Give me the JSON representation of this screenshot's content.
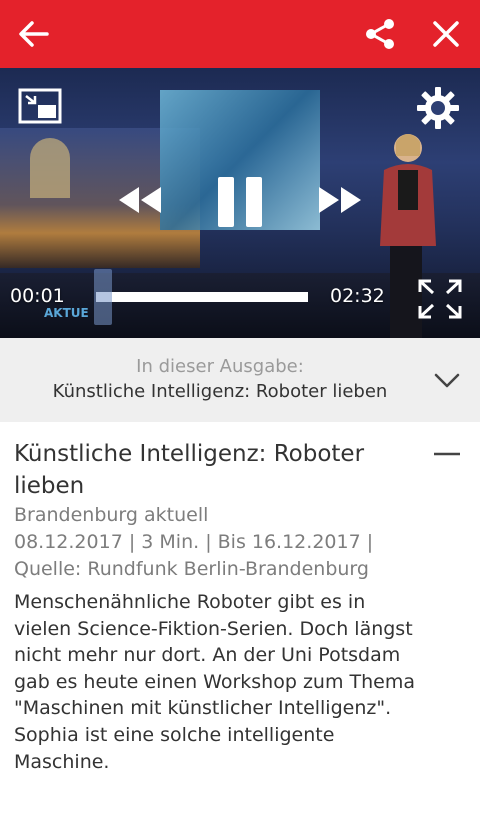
{
  "colors": {
    "brand_red": "#e4222b",
    "panel_grey": "#efefef"
  },
  "topbar": {
    "icons": {
      "back": "arrow-left-icon",
      "share": "share-icon",
      "close": "close-icon"
    }
  },
  "player": {
    "current_time": "00:01",
    "duration": "02:32",
    "progress_fraction": 0.007,
    "ticker": "AKTUE",
    "icons": {
      "pip": "picture-in-picture-icon",
      "settings": "gear-icon",
      "rewind": "rewind-icon",
      "pause": "pause-icon",
      "forward": "fast-forward-icon",
      "fullscreen": "fullscreen-icon"
    }
  },
  "issue_bar": {
    "label": "In dieser Ausgabe:",
    "selected": "Künstliche Intelligenz: Roboter lieben",
    "icon": "chevron-down-icon"
  },
  "detail": {
    "title": "Künstliche Intelligenz: Roboter lieben",
    "program": "Brandenburg aktuell",
    "meta": "08.12.2017 | 3 Min. | Bis 16.12.2017 |",
    "source": "Quelle: Rundfunk Berlin-Brandenburg",
    "description": "Menschenähnliche Roboter gibt es in vielen Science-Fiktion-Serien. Doch längst nicht mehr nur dort. An der Uni Potsdam gab es heute einen Workshop zum Thema \"Maschinen mit künstlicher Intelligenz\". Sophia ist eine solche intelligente Maschine.",
    "collapse_icon": "minus-icon"
  }
}
